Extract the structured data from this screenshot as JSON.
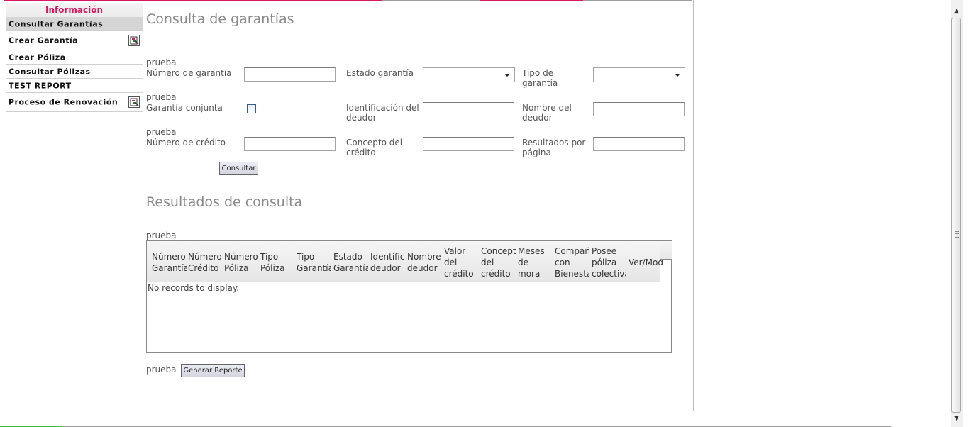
{
  "sidebar": {
    "header": "Información",
    "items": [
      {
        "label": "Consultar Garantías",
        "active": true,
        "icon": null
      },
      {
        "label": "Crear Garantía",
        "active": false,
        "icon": "report-app-icon"
      },
      {
        "label": "Crear Póliza",
        "active": false,
        "icon": null
      },
      {
        "label": "Consultar Pólizas",
        "active": false,
        "icon": null
      },
      {
        "label": "TEST REPORT",
        "active": false,
        "icon": null
      },
      {
        "label": "Proceso de Renovación",
        "active": false,
        "icon": "report-app-icon"
      }
    ]
  },
  "search": {
    "title": "Consulta de garantías",
    "row_prefix": "prueba",
    "fields": {
      "numero_garantia": {
        "label": "Número de garantía",
        "value": ""
      },
      "estado_garantia": {
        "label": "Estado garantía",
        "value": ""
      },
      "tipo_garantia": {
        "label": "Tipo de garantía",
        "value": ""
      },
      "garantia_conjunta": {
        "label": "Garantía conjunta",
        "checked": false
      },
      "identificacion_deudor": {
        "label": "Identificación del deudor",
        "value": ""
      },
      "nombre_deudor": {
        "label": "Nombre del deudor",
        "value": ""
      },
      "numero_credito": {
        "label": "Número de crédito",
        "value": ""
      },
      "concepto_credito": {
        "label": "Concepto del crédito",
        "value": ""
      },
      "resultados_pagina": {
        "label": "Resultados por página",
        "value": ""
      }
    },
    "button": "Consultar"
  },
  "results": {
    "title": "Resultados de consulta",
    "prefix": "prueba",
    "columns": [
      "Número\nGarantía",
      "Número\nCrédito",
      "Número\nPóliza",
      "Tipo\nPóliza",
      "Tipo\nGarantía",
      "Estado\nGarantía",
      "Identificación\ndeudor",
      "Nombre\ndeudor",
      "Valor\ndel\ncrédito",
      "Concepto\ndel\ncrédito",
      "Meses\nde\nmora",
      "Compañía\ncon\nBienestar",
      "Posee\npóliza\ncolectiva",
      "Ver/Modificar"
    ],
    "empty_message": "No records to display.",
    "report_prefix": "prueba",
    "report_button": "Generar Reporte"
  },
  "colors": {
    "accent": "#d9185f",
    "active_item": "#d5d5d5",
    "title": "#8a8a8a"
  }
}
